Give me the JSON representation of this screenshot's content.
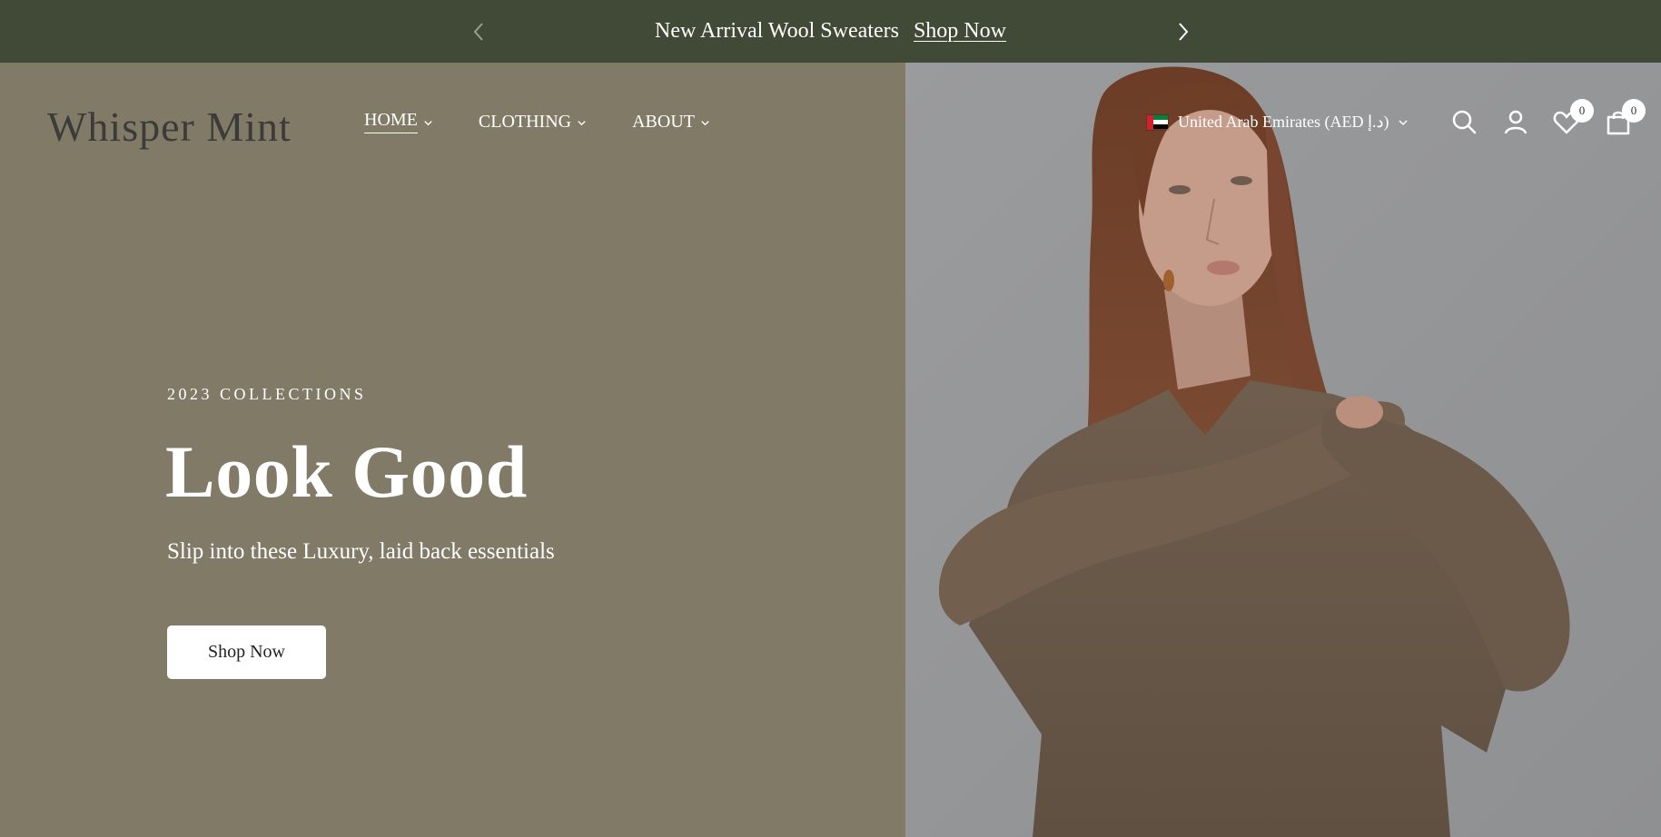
{
  "announcement": {
    "text": "New Arrival Wool Sweaters",
    "link": "Shop Now",
    "prev_icon": "chevron-left-icon",
    "next_icon": "chevron-right-icon"
  },
  "header": {
    "logo": "Whisper Mint",
    "nav": [
      {
        "label": "HOME",
        "active": true
      },
      {
        "label": "CLOTHING",
        "active": false
      },
      {
        "label": "ABOUT",
        "active": false
      }
    ],
    "locale": "United Arab Emirates (AED د.إ)",
    "wishlist_count": "0",
    "cart_count": "0"
  },
  "hero": {
    "eyebrow": "2023 COLLECTIONS",
    "headline": "Look Good",
    "subtext": "Slip into these Luxury, laid back essentials",
    "cta": "Shop Now"
  },
  "colors": {
    "announcement_bg": "#414a36",
    "hero_left_bg": "#807a67",
    "hero_right_bg": "#98999b"
  }
}
